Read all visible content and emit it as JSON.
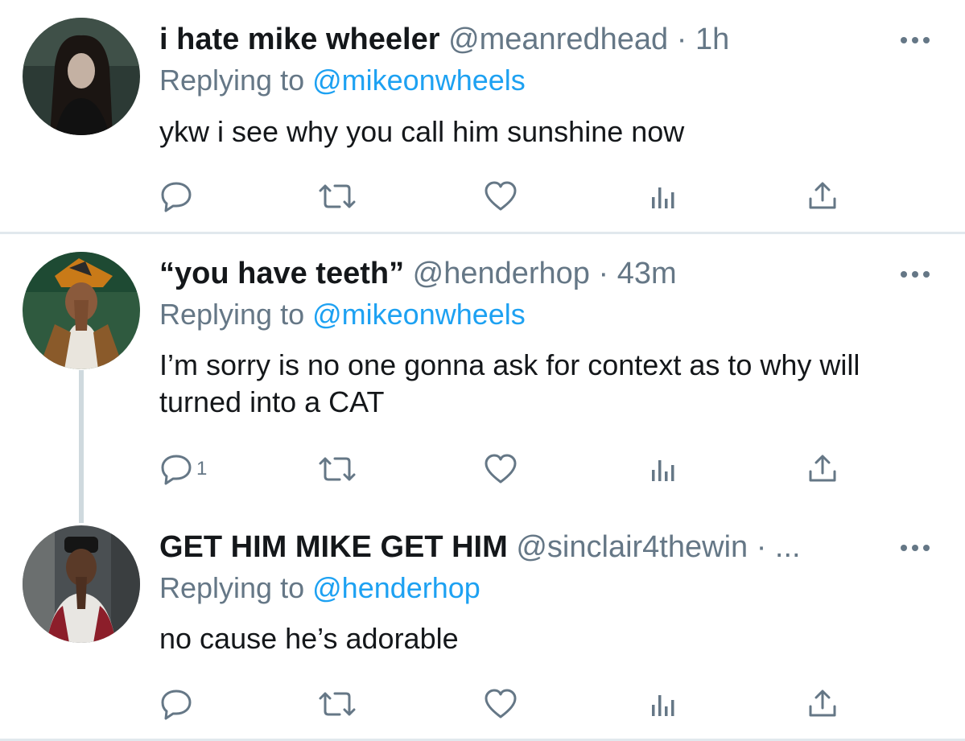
{
  "tweets": [
    {
      "display_name": "i hate mike wheeler",
      "handle": "@meanredhead",
      "separator": "·",
      "time": "1h",
      "replying_prefix": "Replying to",
      "replying_to": "@mikeonwheels",
      "text": "ykw i see why you call him sunshine now",
      "reply_count": "",
      "avatar": "avatar-dark-haired-girl"
    },
    {
      "display_name": "“you have teeth”",
      "handle": "@henderhop",
      "separator": "·",
      "time": "43m",
      "replying_prefix": "Replying to",
      "replying_to": "@mikeonwheels",
      "text": "I’m sorry is no one gonna ask for context as to why will turned into a CAT",
      "reply_count": "1",
      "avatar": "avatar-boy-with-hat"
    },
    {
      "display_name": "GET HIM MIKE GET HIM",
      "handle": "@sinclair4thewin",
      "separator": "· ...",
      "time": "",
      "replying_prefix": "Replying to",
      "replying_to": "@henderhop",
      "text": "no cause he’s adorable",
      "reply_count": "",
      "avatar": "avatar-boy-in-jacket"
    }
  ],
  "colors": {
    "link": "#1da1f2",
    "muted": "#657786",
    "text": "#14171a",
    "divider": "#e1e8ed"
  },
  "icons": [
    "reply-icon",
    "retweet-icon",
    "like-icon",
    "views-icon",
    "share-icon",
    "more-icon"
  ]
}
